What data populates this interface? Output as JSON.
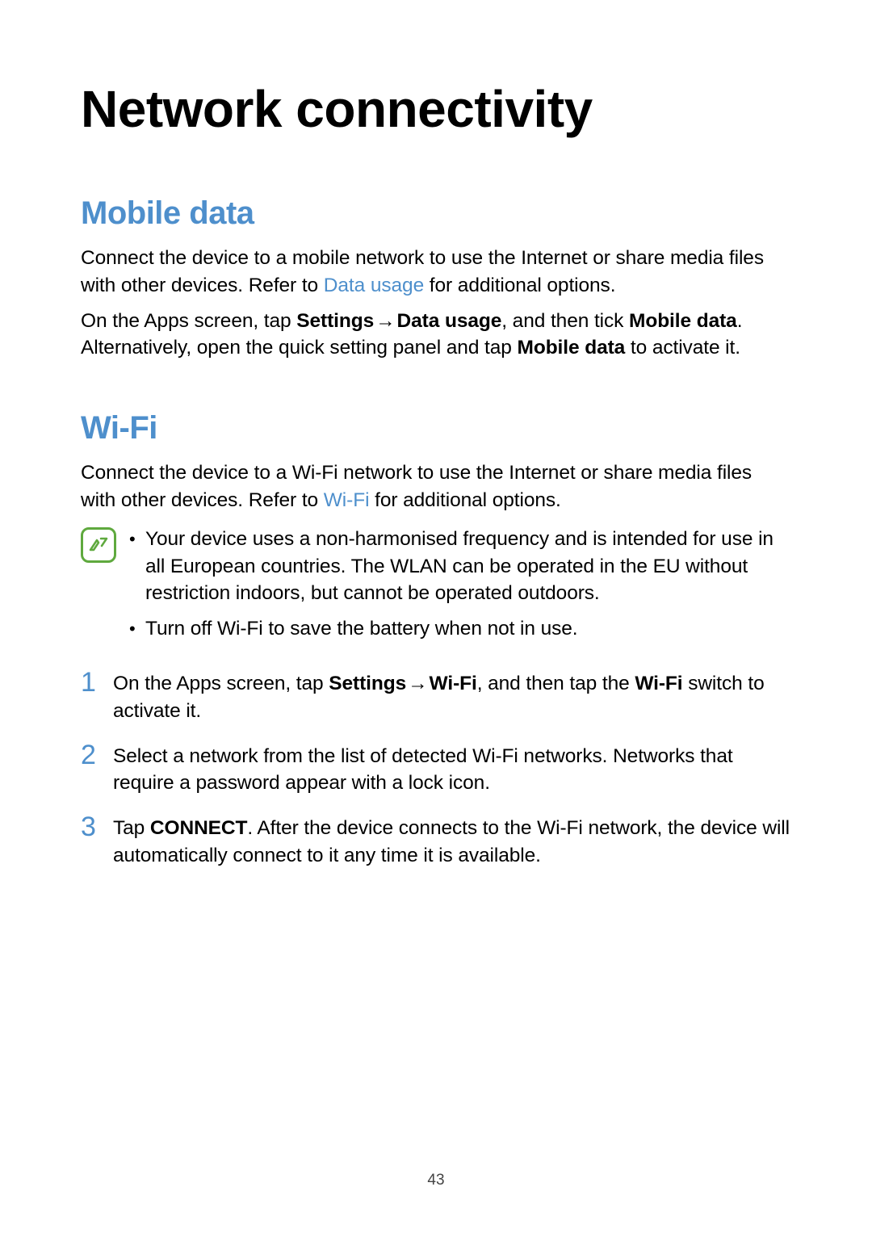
{
  "pageTitle": "Network connectivity",
  "pageNumber": "43",
  "mobileData": {
    "heading": "Mobile data",
    "p1_pre": "Connect the device to a mobile network to use the Internet or share media files with other devices. Refer to ",
    "p1_link": "Data usage",
    "p1_post": " for additional options.",
    "p2_a": "On the Apps screen, tap ",
    "p2_settings": "Settings",
    "p2_arrow": " → ",
    "p2_datausage": "Data usage",
    "p2_b": ", and then tick ",
    "p2_mobiledata": "Mobile data",
    "p2_c": ". Alternatively, open the quick setting panel and tap ",
    "p2_mobiledata2": "Mobile data",
    "p2_d": " to activate it."
  },
  "wifi": {
    "heading": "Wi-Fi",
    "p1_pre": "Connect the device to a Wi-Fi network to use the Internet or share media files with other devices. Refer to ",
    "p1_link": "Wi-Fi",
    "p1_post": " for additional options.",
    "notes": {
      "item1": "Your device uses a non-harmonised frequency and is intended for use in all European countries. The WLAN can be operated in the EU without restriction indoors, but cannot be operated outdoors.",
      "item2": "Turn off Wi-Fi to save the battery when not in use."
    },
    "steps": {
      "s1_a": "On the Apps screen, tap ",
      "s1_settings": "Settings",
      "s1_arrow": " → ",
      "s1_wifi": "Wi-Fi",
      "s1_b": ", and then tap the ",
      "s1_wifi2": "Wi-Fi",
      "s1_c": " switch to activate it.",
      "s2": "Select a network from the list of detected Wi-Fi networks. Networks that require a password appear with a lock icon.",
      "s3_a": "Tap ",
      "s3_connect": "CONNECT",
      "s3_b": ". After the device connects to the Wi-Fi network, the device will automatically connect to it any time it is available."
    }
  }
}
